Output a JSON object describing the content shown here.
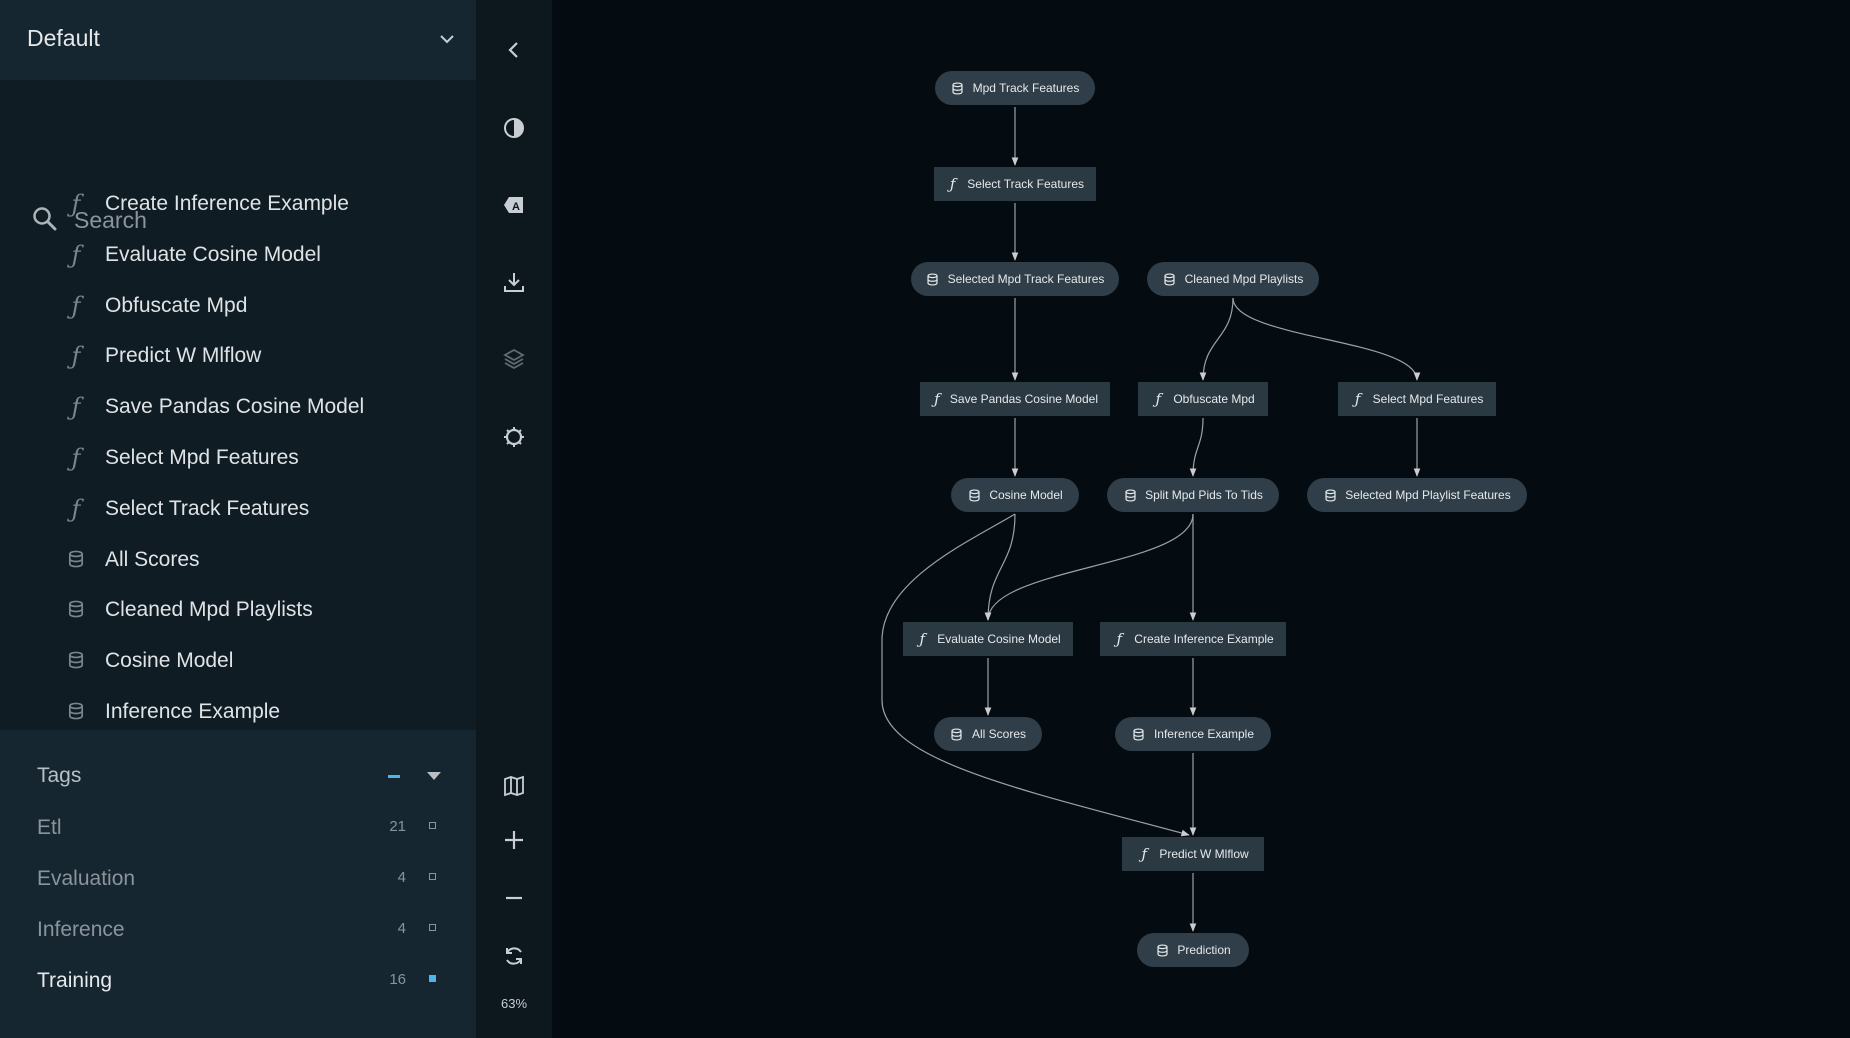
{
  "pipeline_selector": {
    "value": "Default"
  },
  "search": {
    "placeholder": "Search"
  },
  "node_list": [
    {
      "label": "Create Inference Example",
      "kind": "task",
      "icon": "function-icon"
    },
    {
      "label": "Evaluate Cosine Model",
      "kind": "task",
      "icon": "function-icon"
    },
    {
      "label": "Obfuscate Mpd",
      "kind": "task",
      "icon": "function-icon"
    },
    {
      "label": "Predict W Mlflow",
      "kind": "task",
      "icon": "function-icon"
    },
    {
      "label": "Save Pandas Cosine Model",
      "kind": "task",
      "icon": "function-icon"
    },
    {
      "label": "Select Mpd Features",
      "kind": "task",
      "icon": "function-icon"
    },
    {
      "label": "Select Track Features",
      "kind": "task",
      "icon": "function-icon"
    },
    {
      "label": "All Scores",
      "kind": "data",
      "icon": "database-icon"
    },
    {
      "label": "Cleaned Mpd Playlists",
      "kind": "data",
      "icon": "database-icon"
    },
    {
      "label": "Cosine Model",
      "kind": "data",
      "icon": "database-icon"
    },
    {
      "label": "Inference Example",
      "kind": "data",
      "icon": "database-icon"
    }
  ],
  "tags": {
    "title": "Tags",
    "items": [
      {
        "name": "Etl",
        "count": "21",
        "active": false
      },
      {
        "name": "Evaluation",
        "count": "4",
        "active": false
      },
      {
        "name": "Inference",
        "count": "4",
        "active": false
      },
      {
        "name": "Training",
        "count": "16",
        "active": true
      }
    ]
  },
  "toolbar": {
    "buttons": [
      "collapse-sidebar-icon",
      "theme-toggle-icon",
      "label-toggle-icon",
      "export-icon",
      "layers-icon",
      "settings-icon",
      "minimap-icon",
      "zoom-in-icon",
      "zoom-out-icon",
      "reset-zoom-icon"
    ],
    "zoom_level": "63%"
  },
  "graph": {
    "nodes": [
      {
        "id": "mpd-track-features",
        "label": "Mpd Track Features",
        "kind": "data"
      },
      {
        "id": "select-track-features",
        "label": "Select Track Features",
        "kind": "task"
      },
      {
        "id": "selected-mpd-track-features",
        "label": "Selected Mpd Track Features",
        "kind": "data"
      },
      {
        "id": "cleaned-mpd-playlists",
        "label": "Cleaned Mpd Playlists",
        "kind": "data"
      },
      {
        "id": "save-pandas-cosine-model",
        "label": "Save Pandas Cosine Model",
        "kind": "task"
      },
      {
        "id": "obfuscate-mpd",
        "label": "Obfuscate Mpd",
        "kind": "task"
      },
      {
        "id": "select-mpd-features",
        "label": "Select Mpd Features",
        "kind": "task"
      },
      {
        "id": "cosine-model",
        "label": "Cosine Model",
        "kind": "data"
      },
      {
        "id": "split-mpd-pids-to-tids",
        "label": "Split Mpd Pids To Tids",
        "kind": "data"
      },
      {
        "id": "selected-mpd-playlist-features",
        "label": "Selected Mpd Playlist Features",
        "kind": "data"
      },
      {
        "id": "evaluate-cosine-model",
        "label": "Evaluate Cosine Model",
        "kind": "task"
      },
      {
        "id": "create-inference-example",
        "label": "Create Inference Example",
        "kind": "task"
      },
      {
        "id": "all-scores",
        "label": "All Scores",
        "kind": "data"
      },
      {
        "id": "inference-example",
        "label": "Inference Example",
        "kind": "data"
      },
      {
        "id": "predict-w-mlflow",
        "label": "Predict W Mlflow",
        "kind": "task"
      },
      {
        "id": "prediction",
        "label": "Prediction",
        "kind": "data"
      }
    ],
    "edges": [
      [
        "mpd-track-features",
        "select-track-features"
      ],
      [
        "select-track-features",
        "selected-mpd-track-features"
      ],
      [
        "selected-mpd-track-features",
        "save-pandas-cosine-model"
      ],
      [
        "cleaned-mpd-playlists",
        "obfuscate-mpd"
      ],
      [
        "cleaned-mpd-playlists",
        "select-mpd-features"
      ],
      [
        "save-pandas-cosine-model",
        "cosine-model"
      ],
      [
        "obfuscate-mpd",
        "split-mpd-pids-to-tids"
      ],
      [
        "select-mpd-features",
        "selected-mpd-playlist-features"
      ],
      [
        "cosine-model",
        "evaluate-cosine-model"
      ],
      [
        "split-mpd-pids-to-tids",
        "evaluate-cosine-model"
      ],
      [
        "split-mpd-pids-to-tids",
        "create-inference-example"
      ],
      [
        "evaluate-cosine-model",
        "all-scores"
      ],
      [
        "create-inference-example",
        "inference-example"
      ],
      [
        "inference-example",
        "predict-w-mlflow"
      ],
      [
        "cosine-model",
        "predict-w-mlflow"
      ],
      [
        "predict-w-mlflow",
        "prediction"
      ]
    ]
  }
}
